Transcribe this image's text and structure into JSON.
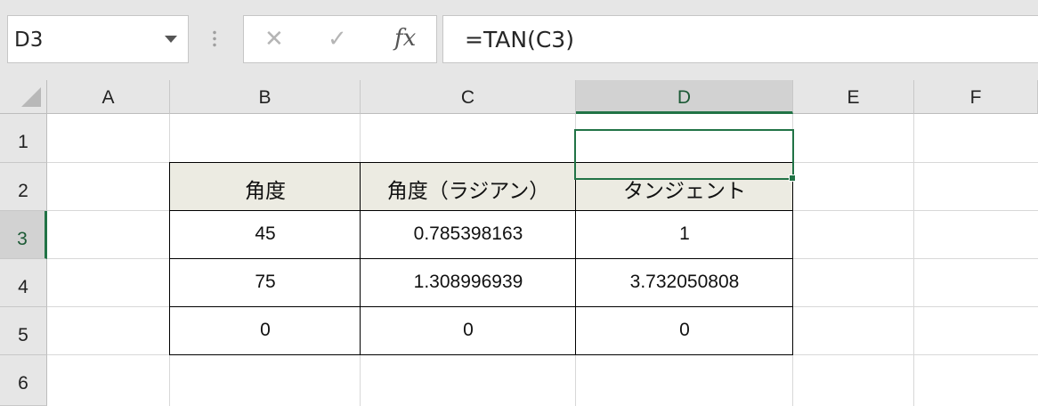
{
  "formula_bar": {
    "name_box": "D3",
    "cancel_icon": "✕",
    "enter_icon": "✓",
    "fx_label": "fx",
    "formula": "=TAN(C3)"
  },
  "columns": [
    "A",
    "B",
    "C",
    "D",
    "E",
    "F"
  ],
  "rows": [
    "1",
    "2",
    "3",
    "4",
    "5",
    "6"
  ],
  "table": {
    "headers": [
      "角度",
      "角度（ラジアン）",
      "タンジェント"
    ],
    "rows": [
      [
        "45",
        "0.785398163",
        "1"
      ],
      [
        "75",
        "1.308996939",
        "3.732050808"
      ],
      [
        "0",
        "0",
        "0"
      ]
    ]
  },
  "selection": {
    "cell": "D3",
    "accent_color": "#217346"
  }
}
